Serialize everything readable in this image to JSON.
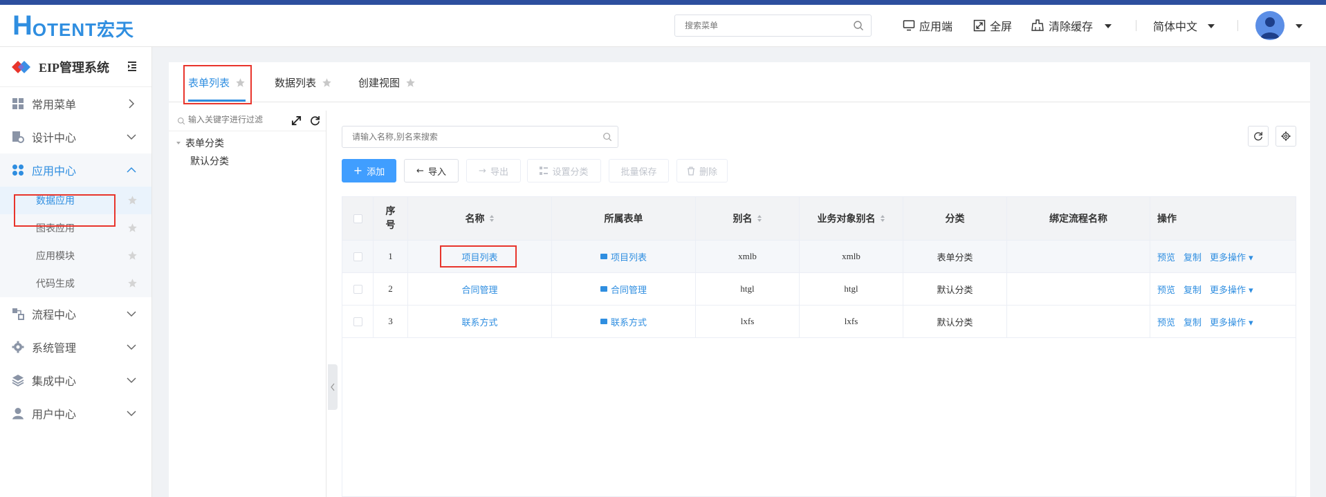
{
  "header": {
    "logo_h": "H",
    "logo_rest": "OTENT宏天",
    "search_placeholder": "搜索菜单",
    "app_label": "应用端",
    "fullscreen_label": "全屏",
    "clear_cache_label": "清除缓存",
    "language_label": "简体中文"
  },
  "sidebar": {
    "title": "EIP管理系统",
    "menus": [
      {
        "label": "常用菜单",
        "icon": "grid-icon"
      },
      {
        "label": "设计中心",
        "icon": "design-icon"
      },
      {
        "label": "应用中心",
        "icon": "apps-icon"
      },
      {
        "label": "流程中心",
        "icon": "flow-icon"
      },
      {
        "label": "系统管理",
        "icon": "gear-icon"
      },
      {
        "label": "集成中心",
        "icon": "layers-icon"
      },
      {
        "label": "用户中心",
        "icon": "user-icon"
      }
    ],
    "sub_items": [
      "数据应用",
      "图表应用",
      "应用模块",
      "代码生成"
    ]
  },
  "tabs": [
    {
      "label": "表单列表"
    },
    {
      "label": "数据列表"
    },
    {
      "label": "创建视图"
    }
  ],
  "tree": {
    "filter_placeholder": "输入关键字进行过滤",
    "root": "表单分类",
    "child": "默认分类"
  },
  "toolbar": {
    "search_placeholder": "请输入名称,别名来搜索",
    "add": "添加",
    "import": "导入",
    "export": "导出",
    "set_category": "设置分类",
    "batch_save": "批量保存",
    "delete": "删除"
  },
  "table": {
    "headers": {
      "index": "序号",
      "name": "名称",
      "form": "所属表单",
      "alias": "别名",
      "bo_alias": "业务对象别名",
      "category": "分类",
      "flow": "绑定流程名称",
      "ops": "操作"
    },
    "rows": [
      {
        "index": "1",
        "name": "项目列表",
        "form": "项目列表",
        "alias": "xmlb",
        "bo_alias": "xmlb",
        "category": "表单分类",
        "flow": ""
      },
      {
        "index": "2",
        "name": "合同管理",
        "form": "合同管理",
        "alias": "htgl",
        "bo_alias": "htgl",
        "category": "默认分类",
        "flow": ""
      },
      {
        "index": "3",
        "name": "联系方式",
        "form": "联系方式",
        "alias": "lxfs",
        "bo_alias": "lxfs",
        "category": "默认分类",
        "flow": ""
      }
    ],
    "ops": {
      "preview": "预览",
      "copy": "复制",
      "more": "更多操作"
    }
  },
  "colors": {
    "accent": "#2f8ee0",
    "primary_button": "#409eff",
    "highlight_box": "#e8342b"
  }
}
